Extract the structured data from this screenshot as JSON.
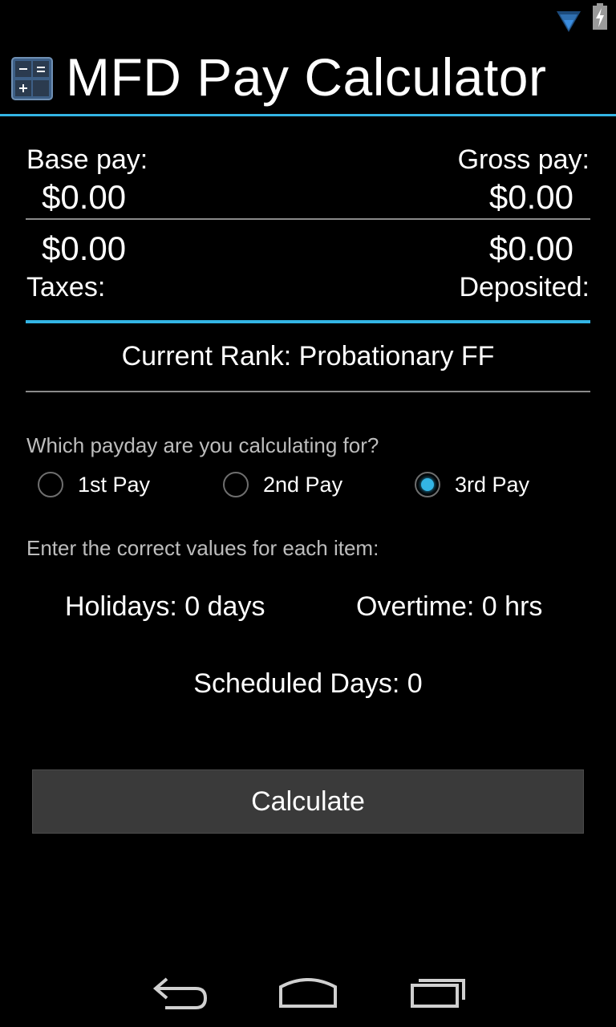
{
  "app": {
    "title": "MFD Pay Calculator"
  },
  "summary": {
    "base_pay_label": "Base pay:",
    "base_pay_value": "$0.00",
    "gross_pay_label": "Gross pay:",
    "gross_pay_value": "$0.00",
    "taxes_value": "$0.00",
    "taxes_label": "Taxes:",
    "deposited_value": "$0.00",
    "deposited_label": "Deposited:"
  },
  "rank": {
    "text": "Current Rank: Probationary FF"
  },
  "payday": {
    "prompt": "Which payday are you calculating for?",
    "options": [
      {
        "label": "1st Pay",
        "checked": false
      },
      {
        "label": "2nd Pay",
        "checked": false
      },
      {
        "label": "3rd Pay",
        "checked": true
      }
    ]
  },
  "items": {
    "prompt": "Enter the correct values for each item:",
    "holidays": "Holidays: 0 days",
    "overtime": "Overtime: 0 hrs",
    "scheduled_days": "Scheduled Days: 0"
  },
  "calculate_button": {
    "label": "Calculate"
  },
  "colors": {
    "accent": "#33b5e5",
    "background": "#000000",
    "button": "#3a3a3a"
  },
  "icons": {
    "status": [
      "wifi-icon",
      "battery-charging-icon"
    ],
    "app": "calculator-icon",
    "nav": [
      "back-icon",
      "home-icon",
      "recent-apps-icon"
    ]
  }
}
